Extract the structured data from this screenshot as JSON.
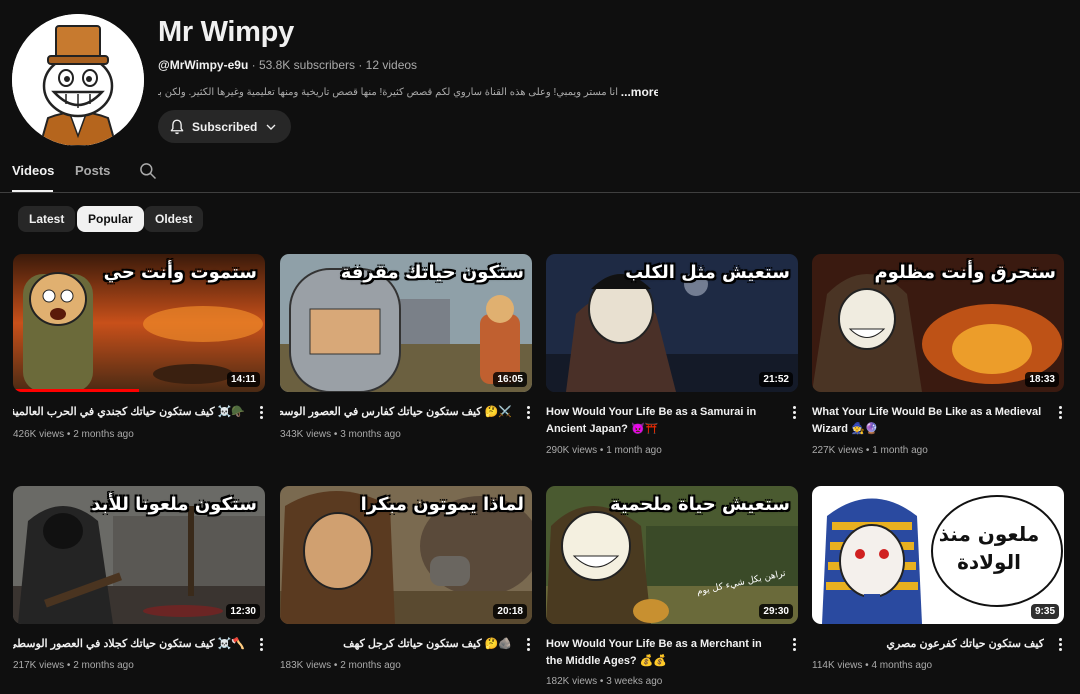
{
  "channel": {
    "name": "Mr Wimpy",
    "handle": "@MrWimpy-e9u",
    "stats": "· 53.8K subscribers · 12 videos",
    "description": "أنا مستر ويمبي! وعلى هذه القناة سأروي لكم قصص كثيرة! منها قصص تاريخية ومنها تعليمية وغيرها الكثير. ولكن بأسلوب",
    "more_label": "...more",
    "subscribe_label": "Subscribed"
  },
  "tabs": [
    {
      "label": "Videos"
    },
    {
      "label": "Posts"
    }
  ],
  "filters": [
    {
      "label": "Latest"
    },
    {
      "label": "Popular"
    },
    {
      "label": "Oldest"
    }
  ],
  "videos": [
    {
      "overlay": "ستموت وأنت حي",
      "duration": "14:11",
      "title": "🪖☠️ كيف ستكون حياتك كجندي في الحرب العالمية الأولى",
      "views": "426K views",
      "age": "2 months ago",
      "watched_fraction": 0.5
    },
    {
      "overlay": "ستكون حياتك مقرفة",
      "duration": "16:05",
      "title": "⚔️🤔 كيف ستكون حياتك كفارس في العصور الوسطى",
      "views": "343K views",
      "age": "3 months ago"
    },
    {
      "overlay": "ستعيش مثل الكلب",
      "duration": "21:52",
      "title": "How Would Your Life Be as a Samurai in Ancient Japan? 👿⛩️",
      "views": "290K views",
      "age": "1 month ago"
    },
    {
      "overlay": "ستحرق وأنت مظلوم",
      "duration": "18:33",
      "title": "What Your Life Would Be Like as a Medieval Wizard 🧙🔮",
      "views": "227K views",
      "age": "1 month ago"
    },
    {
      "overlay": "ستكون ملعونا للأبد",
      "duration": "12:30",
      "title": "🪓☠️ كيف ستكون حياتك كجلاد في العصور الوسطى",
      "views": "217K views",
      "age": "2 months ago"
    },
    {
      "overlay": "لماذا يموتون مبكرا",
      "duration": "20:18",
      "title": "🪨🤔 كيف ستكون حياتك كرجل كهف",
      "views": "183K views",
      "age": "2 months ago"
    },
    {
      "overlay": "ستعيش حياة ملحمية",
      "duration": "29:30",
      "title": "How Would Your Life Be as a Merchant in the Middle Ages? 💰💰",
      "views": "182K views",
      "age": "3 weeks ago",
      "caption": "تراهن بكل شيء كل يوم"
    },
    {
      "overlay": "ملعون منذ الولادة",
      "duration": "9:35",
      "title": "كيف ستكون حياتك كفرعون مصري",
      "views": "114K views",
      "age": "4 months ago"
    }
  ],
  "colors": {
    "background": "#0f0f0f",
    "chip_active": "#f1f1f1",
    "chip_inactive": "#272727",
    "progress": "#ff0000",
    "secondary_text": "#aaaaaa"
  }
}
